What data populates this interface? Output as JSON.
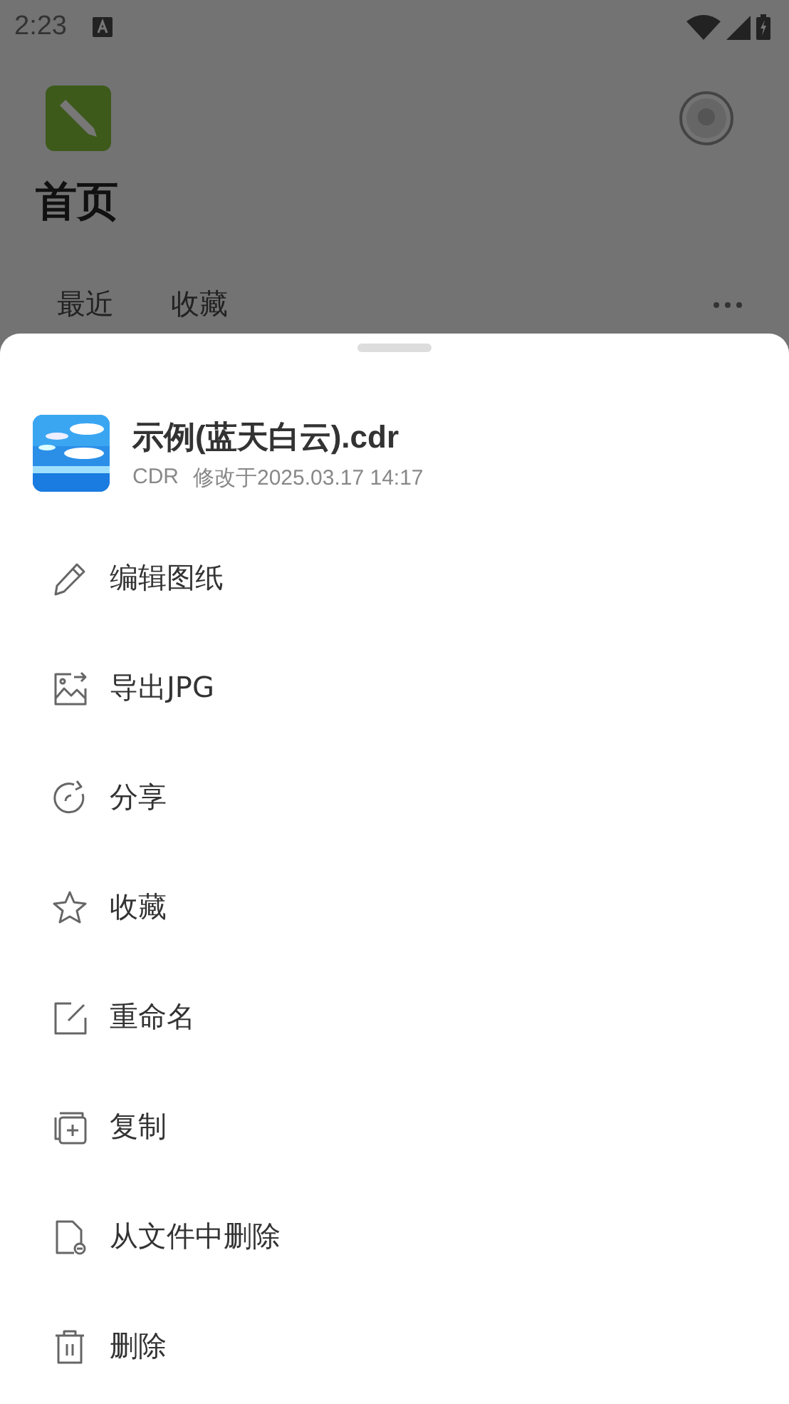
{
  "status_bar": {
    "time": "2:23"
  },
  "page": {
    "title": "首页",
    "tabs": [
      "最近",
      "收藏"
    ]
  },
  "sheet": {
    "file": {
      "name": "示例(蓝天白云).cdr",
      "type": "CDR",
      "modified": "修改于2025.03.17 14:17"
    },
    "actions": [
      "编辑图纸",
      "导出JPG",
      "分享",
      "收藏",
      "重命名",
      "复制",
      "从文件中删除",
      "删除"
    ]
  }
}
